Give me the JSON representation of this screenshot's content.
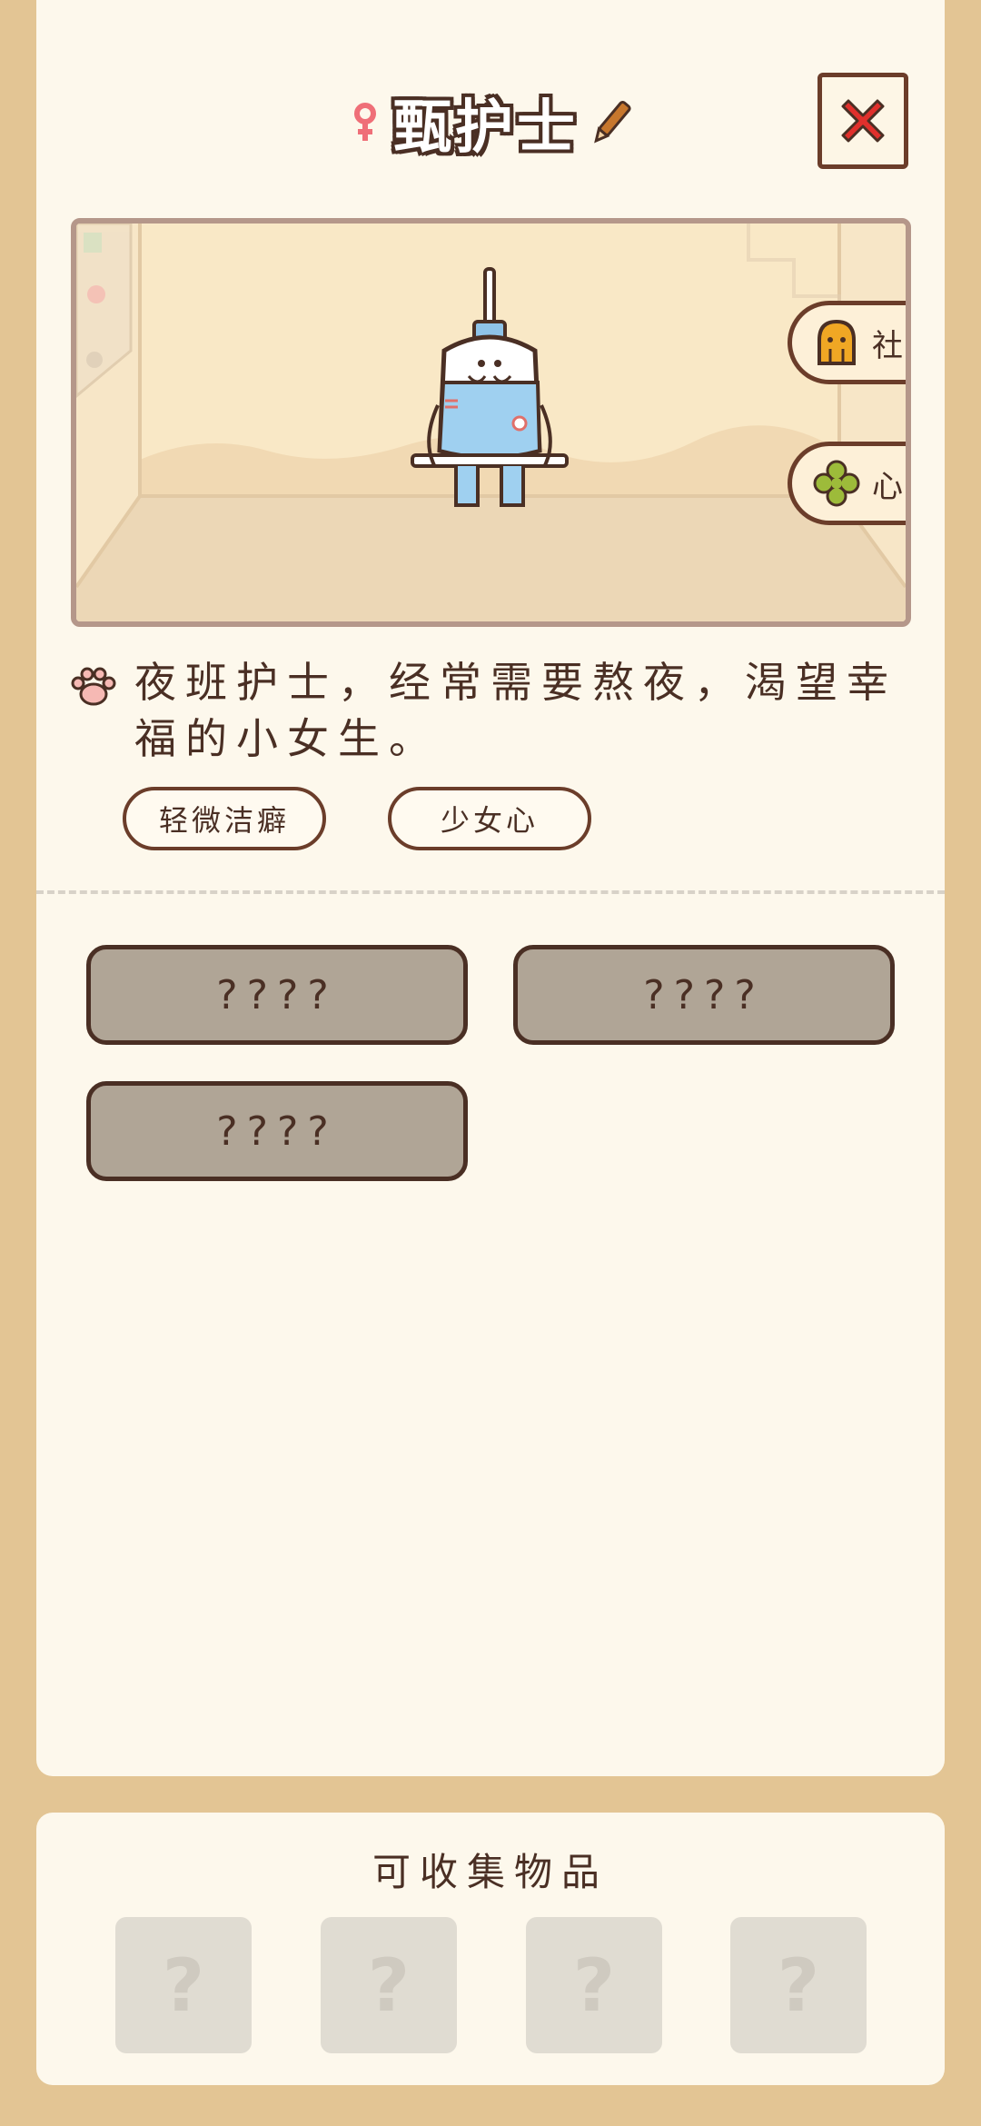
{
  "header": {
    "name": "甄护士",
    "gender_icon": "female-icon",
    "edit_icon": "pencil-icon",
    "close_icon": "close-x-icon"
  },
  "scene": {
    "buttons": [
      {
        "label": "社交",
        "icon": "social-blob-icon"
      },
      {
        "label": "心愿",
        "icon": "clover-icon"
      }
    ]
  },
  "profile": {
    "description": "夜班护士，经常需要熬夜，渴望幸福的小女生。",
    "tags": [
      "轻微洁癖",
      "少女心"
    ]
  },
  "slots": [
    "????",
    "????",
    "????"
  ],
  "collectibles": {
    "title": "可收集物品",
    "items": [
      "?",
      "?",
      "?",
      "?"
    ]
  },
  "colors": {
    "background": "#e3c594",
    "panel": "#fdf8ec",
    "outline": "#4a2f24",
    "close_red": "#e0302c",
    "locked_slot": "#b0a596"
  }
}
